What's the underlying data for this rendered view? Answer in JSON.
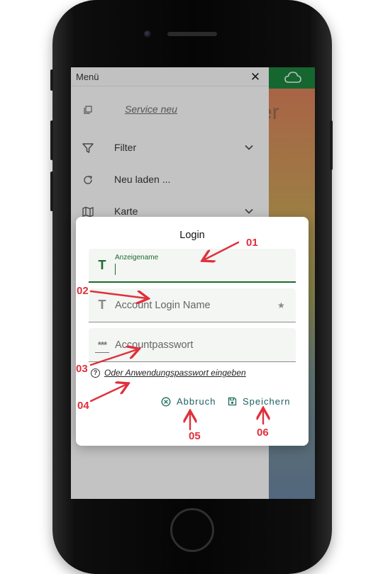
{
  "drawer": {
    "title": "Menü",
    "items": [
      {
        "label": "Service neu",
        "icon": "copy-icon"
      },
      {
        "label": "Filter",
        "icon": "filter-icon"
      },
      {
        "label": "Neu laden ...",
        "icon": "refresh-icon"
      },
      {
        "label": "Karte",
        "icon": "map-icon"
      }
    ]
  },
  "background": {
    "partial_text": "eter"
  },
  "dialog": {
    "title": "Login",
    "fields": [
      {
        "label": "Anzeigename",
        "value": "",
        "icon": "text-icon",
        "active": true
      },
      {
        "placeholder": "Account Login Name",
        "icon": "text-icon",
        "required_mark": "★"
      },
      {
        "placeholder": "Accountpasswort",
        "icon": "password-icon",
        "icon_text": "***"
      }
    ],
    "alt_link": "Oder Anwendungspasswort eingeben",
    "cancel_label": "Abbruch",
    "save_label": "Speichern"
  },
  "annotations": [
    "01",
    "02",
    "03",
    "04",
    "05",
    "06"
  ],
  "colors": {
    "accent": "#1d6b2e",
    "topbar": "#1b7a3a",
    "annotation": "#e0303c"
  }
}
